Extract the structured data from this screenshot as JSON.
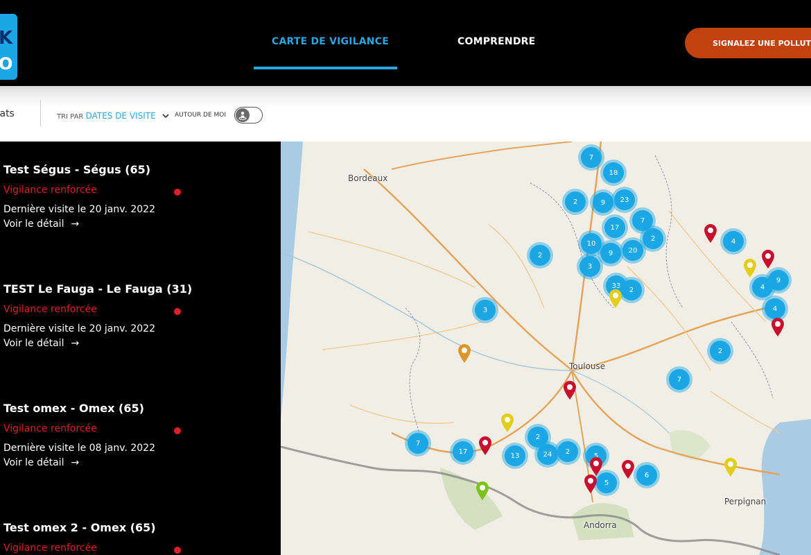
{
  "header": {
    "logo_top": "K",
    "logo_bottom": "O",
    "tabs": [
      {
        "label": "CARTE DE VIGILANCE",
        "active": true
      },
      {
        "label": "COMPRENDRE",
        "active": false
      }
    ],
    "report_button": "SIGNALEZ UNE POLLUTION"
  },
  "filters": {
    "results_label": "tats",
    "sort_prefix": "TRI PAR",
    "sort_value": "DATES DE VISITE",
    "near_me_label": "AUTOUR DE MOI",
    "near_me_on": false
  },
  "sites": [
    {
      "title": "Test Ségus - Ségus (65)",
      "status": "Vigilance renforcée",
      "date": "Dernière visite le 20 janv. 2022",
      "link": "Voir le détail"
    },
    {
      "title": "TEST Le Fauga - Le Fauga (31)",
      "status": "Vigilance renforcée",
      "date": "Dernière visite le 20 janv. 2022",
      "link": "Voir le détail"
    },
    {
      "title": "Test omex - Omex (65)",
      "status": "Vigilance renforcée",
      "date": "Dernière visite le 08 janv. 2022",
      "link": "Voir le détail"
    },
    {
      "title": "Test omex 2 - Omex (65)",
      "status": "Vigilance renforcée",
      "date": "",
      "link": ""
    }
  ],
  "map": {
    "cities": [
      "Bordeaux",
      "Toulouse",
      "Perpignan",
      "Andorra"
    ],
    "clusters": [
      "7",
      "18",
      "2",
      "9",
      "23",
      "17",
      "7",
      "2",
      "10",
      "9",
      "20",
      "2",
      "3",
      "33",
      "2",
      "3",
      "4",
      "4",
      "9",
      "4",
      "2",
      "7",
      "7",
      "17",
      "13",
      "24",
      "2",
      "2",
      "5",
      "5",
      "6"
    ],
    "colors": {
      "cluster": "#1ba6e6",
      "red": "#c8102e",
      "yellow": "#e4cc1a",
      "orange": "#e0952a",
      "green": "#7cc21a",
      "accent": "#2aa5e0",
      "report": "#c2410c"
    }
  }
}
